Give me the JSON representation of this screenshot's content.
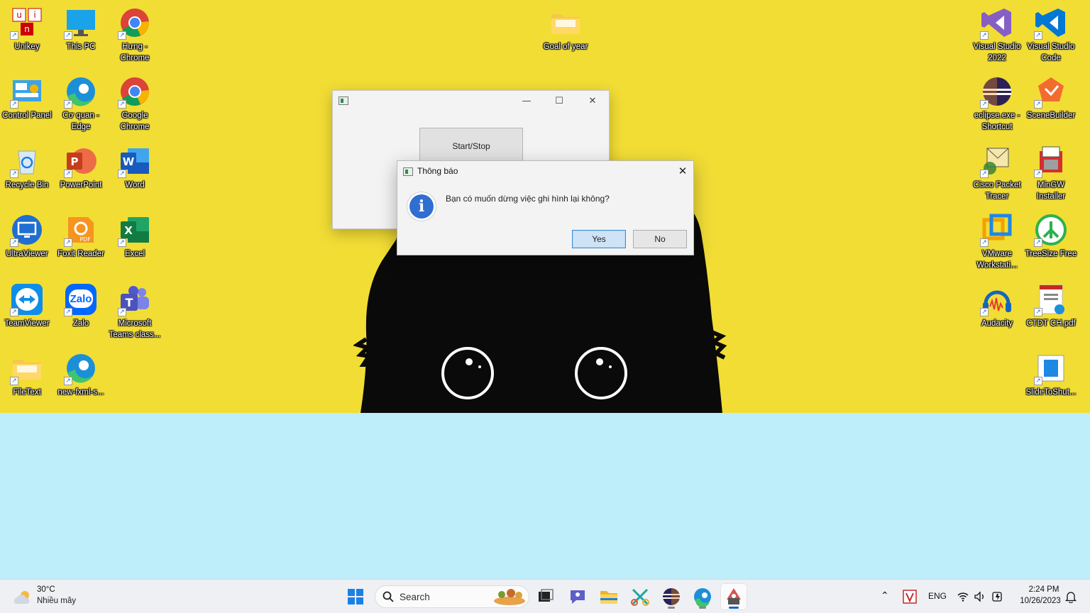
{
  "desktop": {
    "icons_left": [
      {
        "label": "Unikey",
        "icon": "unikey-icon"
      },
      {
        "label": "This PC",
        "icon": "monitor-icon"
      },
      {
        "label": "Hưng - Chrome",
        "icon": "chrome-icon"
      },
      {
        "label": "Control Panel",
        "icon": "control-panel-icon"
      },
      {
        "label": "Cơ quan - Edge",
        "icon": "edge-icon"
      },
      {
        "label": "Google Chrome",
        "icon": "chrome-icon"
      },
      {
        "label": "Recycle Bin",
        "icon": "recycle-bin-icon"
      },
      {
        "label": "PowerPoint",
        "icon": "powerpoint-icon"
      },
      {
        "label": "Word",
        "icon": "word-icon"
      },
      {
        "label": "UltraViewer",
        "icon": "ultraviewer-icon"
      },
      {
        "label": "Foxit Reader",
        "icon": "foxit-icon"
      },
      {
        "label": "Excel",
        "icon": "excel-icon"
      },
      {
        "label": "TeamViewer",
        "icon": "teamviewer-icon"
      },
      {
        "label": "Zalo",
        "icon": "zalo-icon",
        "glyph": "Zalo"
      },
      {
        "label": "Microsoft Teams class...",
        "icon": "teams-icon"
      },
      {
        "label": "FileText",
        "icon": "folder-icon"
      },
      {
        "label": "new-fxml-s...",
        "icon": "edge-icon"
      }
    ],
    "icon_middle": {
      "label": "Goal of year",
      "icon": "folder-icon"
    },
    "icons_right": [
      {
        "label": "Visual Studio 2022",
        "icon": "visual-studio-icon"
      },
      {
        "label": "Visual Studio Code",
        "icon": "vscode-icon"
      },
      {
        "label": "eclipse.exe - Shortcut",
        "icon": "eclipse-icon"
      },
      {
        "label": "SceneBuilder",
        "icon": "scenebuilder-icon"
      },
      {
        "label": "Cisco Packet Tracer",
        "icon": "cisco-icon"
      },
      {
        "label": "MinGW Installer",
        "icon": "mingw-icon"
      },
      {
        "label": "VMware Workstati...",
        "icon": "vmware-icon"
      },
      {
        "label": "TreeSize Free",
        "icon": "treesize-icon"
      },
      {
        "label": "Audacity",
        "icon": "audacity-icon"
      },
      {
        "label": "CTDT CH.pdf",
        "icon": "pdf-icon"
      },
      {
        "label": "SlideToShut...",
        "icon": "slide-icon"
      }
    ]
  },
  "app_window": {
    "minimize_glyph": "—",
    "maximize_glyph": "☐",
    "close_glyph": "✕",
    "button_label": "Start/Stop"
  },
  "dialog": {
    "title": "Thông báo",
    "close_glyph": "✕",
    "info_glyph": "i",
    "message": "Bạn có muốn dừng việc ghi hình lại không?",
    "yes_label": "Yes",
    "no_label": "No"
  },
  "taskbar": {
    "weather": {
      "temperature": "30°C",
      "condition": "Nhiều mây"
    },
    "search_placeholder": "Search",
    "apps": [
      "start-icon",
      "search-icon",
      "task-view-icon",
      "chat-icon",
      "file-explorer-icon",
      "snipping-icon",
      "eclipse-icon",
      "edge-icon",
      "java-app-icon"
    ],
    "tray": {
      "chevron": "⌃",
      "language": "ENG",
      "time": "2:24 PM",
      "date": "10/26/2023"
    }
  },
  "colors": {
    "wallpaper_yellow": "#f2dd35",
    "wallpaper_blue": "#bfeefb",
    "accent": "#1a62c7"
  }
}
